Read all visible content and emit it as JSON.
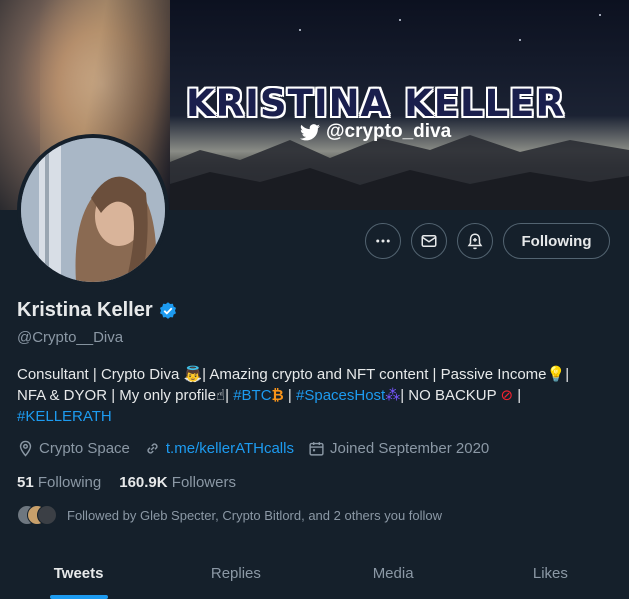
{
  "banner": {
    "title": "KRISTINA KELLER",
    "handle": "@crypto_diva"
  },
  "actions": {
    "more_icon": "more-icon",
    "message_icon": "envelope-icon",
    "notify_icon": "bell-plus-icon",
    "follow_label": "Following"
  },
  "profile": {
    "name": "Kristina Keller",
    "handle": "@Crypto__Diva",
    "verified": true,
    "bio": {
      "line1_a": "Consultant | Crypto Diva ",
      "line1_b": "| Amazing crypto and NFT content | Passive Income",
      "line1_c": "|",
      "line2_a": "NFA & DYOR | My only profile",
      "line2_b": "| ",
      "line2_hash1": "#BTC",
      "line2_c": " | ",
      "line2_hash2": "#SpacesHost",
      "line2_d": "| NO BACKUP ",
      "line2_e": " |",
      "line3_hash": "#KELLERATH"
    },
    "location": "Crypto Space",
    "website": "t.me/kellerATHcalls",
    "joined": "Joined September 2020",
    "following_count": "51",
    "following_label": "Following",
    "followers_count": "160.9K",
    "followers_label": "Followers",
    "followed_by": "Followed by Gleb Specter, Crypto Bitlord, and 2 others you follow"
  },
  "tabs": [
    {
      "label": "Tweets"
    },
    {
      "label": "Replies"
    },
    {
      "label": "Media"
    },
    {
      "label": "Likes"
    }
  ],
  "colors": {
    "background": "#15202b",
    "accent": "#1d9bf0",
    "muted": "#8b98a5"
  }
}
